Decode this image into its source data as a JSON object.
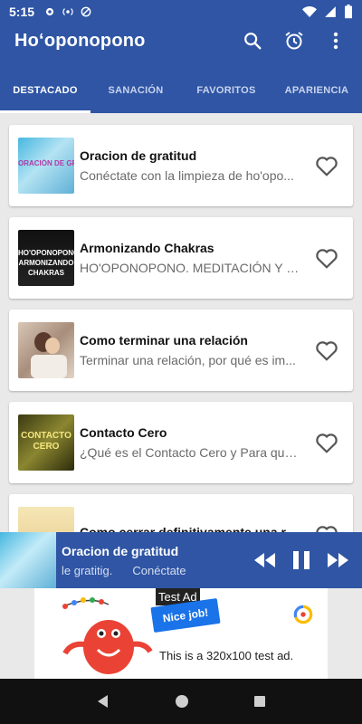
{
  "status": {
    "time": "5:15"
  },
  "app": {
    "title": "Ho‘oponopono"
  },
  "tabs": [
    {
      "label": "DESTACADO",
      "active": true
    },
    {
      "label": "SANACIÓN",
      "active": false
    },
    {
      "label": "FAVORITOS",
      "active": false
    },
    {
      "label": "APARIENCIA",
      "active": false
    }
  ],
  "items": [
    {
      "title": "Oracion de gratitud",
      "subtitle": "Conéctate con la limpieza de ho'opo...",
      "thumb_label": "ORACIÓN DE GRATITUD",
      "icon": "heart-outline-icon"
    },
    {
      "title": "Armonizando Chakras",
      "subtitle": "HO'OPONOPONO. MEDITACIÓN Y P...",
      "thumb_label": "HO'OPONOPONO ARMONIZANDO CHAKRAS",
      "icon": "heart-outline-icon"
    },
    {
      "title": "Como terminar una relación",
      "subtitle": "Terminar una relación, por qué es im...",
      "thumb_label": "",
      "icon": "heart-outline-icon"
    },
    {
      "title": "Contacto Cero",
      "subtitle": "¿Qué es el Contacto Cero y Para qué...",
      "thumb_label": "CONTACTO CERO",
      "icon": "heart-outline-icon"
    },
    {
      "title": "Como cerrar definitivamente una re...",
      "subtitle": "",
      "thumb_label": "",
      "icon": "heart-outline-icon"
    }
  ],
  "player": {
    "title": "Oracion de gratitud",
    "subtitle_left": "le gratitig.",
    "subtitle_right": "Conéctate"
  },
  "ad": {
    "label": "Test Ad",
    "badge": "Nice job!",
    "text": "This is a 320x100 test ad."
  },
  "colors": {
    "primary": "#2f55a4",
    "background": "#e9e9e9"
  }
}
